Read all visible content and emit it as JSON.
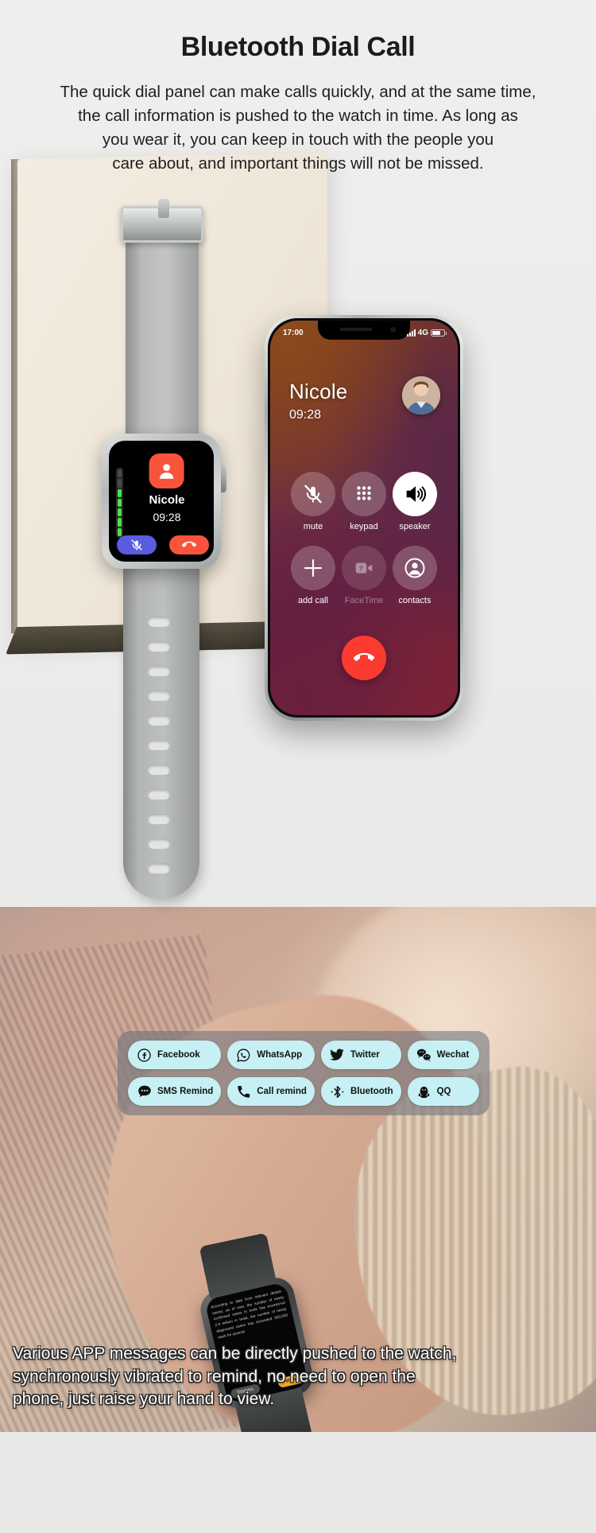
{
  "header": {
    "title": "Bluetooth Dial Call",
    "description_lines": [
      "The quick dial panel can make calls quickly, and at the same time,",
      "the call information is pushed to the watch in time. As long as",
      "you wear it, you can keep in touch with the people you",
      "care about, and important things will not be missed."
    ]
  },
  "phone": {
    "status_bar": {
      "time": "17:00",
      "network": "4G",
      "signal_icon": "signal-bars-icon",
      "battery_icon": "battery-icon"
    },
    "caller_name": "Nicole",
    "call_duration": "09:28",
    "avatar_icon": "contact-photo",
    "controls": [
      {
        "label": "mute",
        "icon": "mute-microphone-icon",
        "state": "normal"
      },
      {
        "label": "keypad",
        "icon": "keypad-icon",
        "state": "normal"
      },
      {
        "label": "speaker",
        "icon": "speaker-icon",
        "state": "active"
      },
      {
        "label": "add call",
        "icon": "plus-icon",
        "state": "normal"
      },
      {
        "label": "FaceTime",
        "icon": "facetime-video-icon",
        "state": "disabled"
      },
      {
        "label": "contacts",
        "icon": "contacts-person-icon",
        "state": "normal"
      }
    ],
    "end_call_icon": "end-call-handset-icon"
  },
  "watch": {
    "caller_name": "Nicole",
    "call_duration": "09:28",
    "avatar_icon": "person-avatar-icon",
    "mute_icon": "mute-microphone-icon",
    "end_call_icon": "end-call-handset-icon",
    "volume_levels_on": 5,
    "volume_levels_off": 2
  },
  "app_badges": [
    {
      "label": "Facebook",
      "icon": "facebook-icon"
    },
    {
      "label": "WhatsApp",
      "icon": "whatsapp-icon"
    },
    {
      "label": "Twitter",
      "icon": "twitter-bird-icon"
    },
    {
      "label": "Wechat",
      "icon": "wechat-icon"
    },
    {
      "label": "SMS Remind",
      "icon": "sms-bubble-icon"
    },
    {
      "label": "Call remind",
      "icon": "phone-handset-icon"
    },
    {
      "label": "Bluetooth",
      "icon": "bluetooth-icon"
    },
    {
      "label": "QQ",
      "icon": "qq-penguin-icon"
    }
  ],
  "wrist_watch": {
    "message_text": "According to date from relevant depart-ments, as of now, the number of newly confirmed cases in India has exceed-ed 2.9 million in India, the number of newly diagnosed cases has exceeded 300,000 mark for several",
    "dismiss_label": "Dismiss",
    "view_label": "View"
  },
  "caption_lines": [
    "Various APP messages can be directly pushed to the watch,",
    "synchronously vibrated to remind, no need to open the",
    "phone, just raise your hand to view."
  ],
  "colors": {
    "page_bg": "#ececeb",
    "badge_bg": "#c6f0f4",
    "accent_red": "#f8543c",
    "accent_blue": "#5a5ce0",
    "accent_green": "#4ae24a",
    "view_orange": "#f5a623"
  }
}
